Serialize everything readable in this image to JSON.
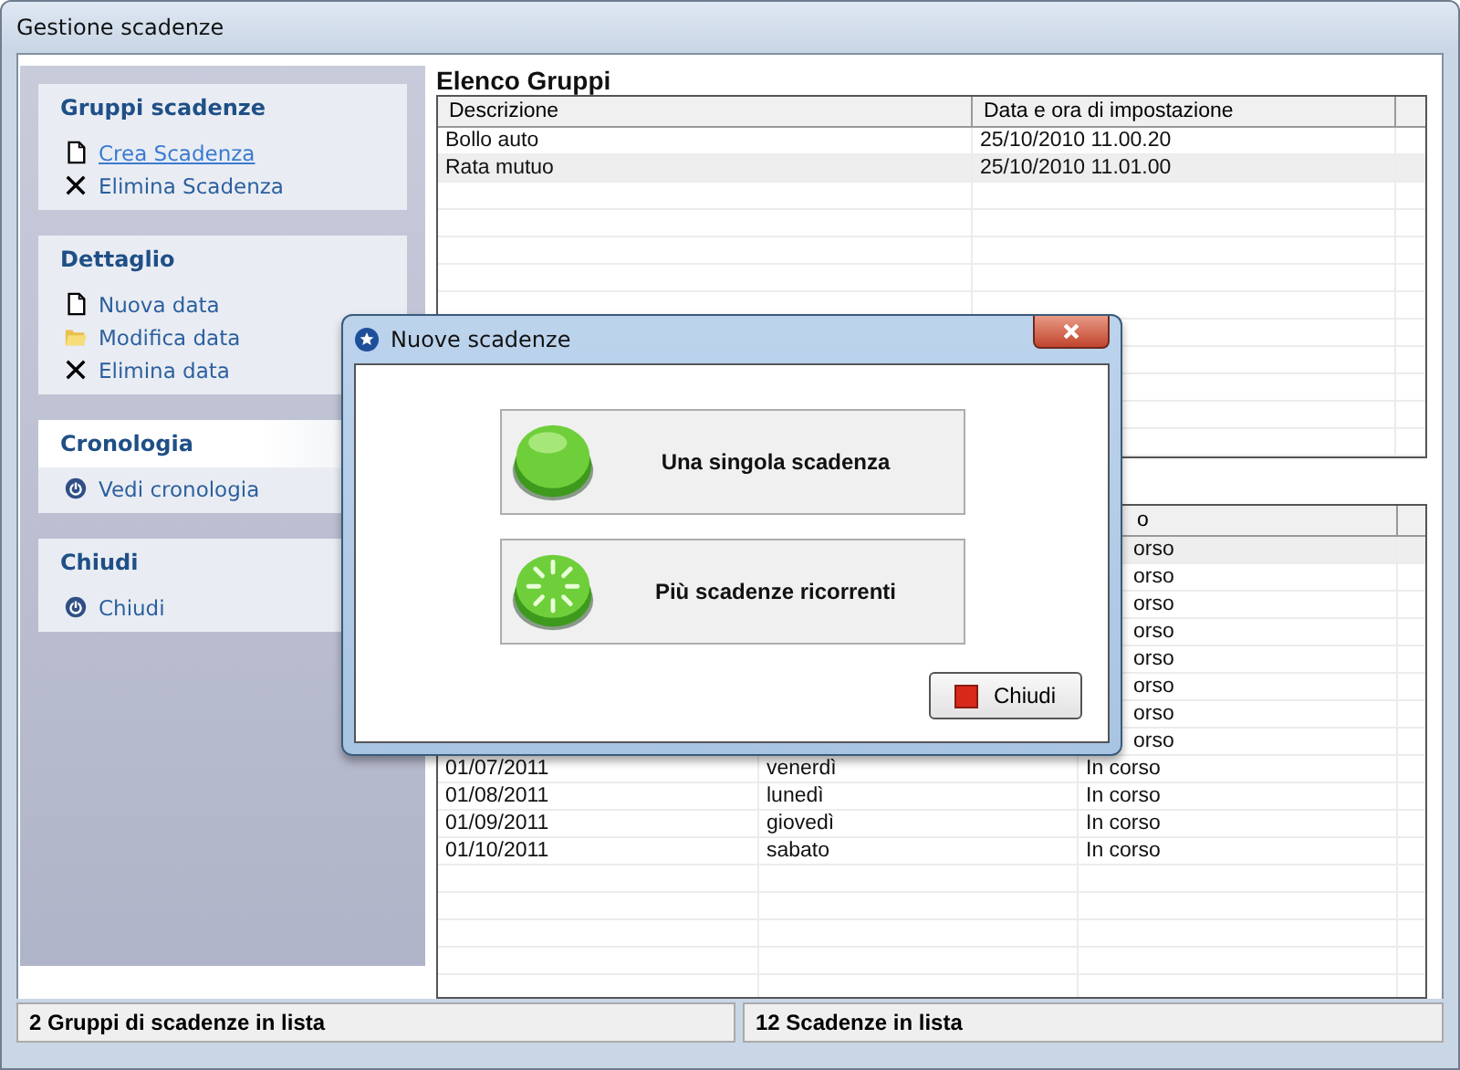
{
  "window": {
    "title": "Gestione scadenze"
  },
  "sidebar": {
    "sections": [
      {
        "title": "Gruppi scadenze",
        "highlighted": false,
        "items": [
          {
            "kind": "new",
            "label": "Crea Scadenza",
            "hovered": true
          },
          {
            "kind": "delete",
            "label": "Elimina Scadenza",
            "hovered": false
          }
        ]
      },
      {
        "title": "Dettaglio",
        "highlighted": false,
        "items": [
          {
            "kind": "new",
            "label": "Nuova data",
            "hovered": false
          },
          {
            "kind": "edit",
            "label": "Modifica data",
            "hovered": false
          },
          {
            "kind": "delete",
            "label": "Elimina data",
            "hovered": false
          }
        ]
      },
      {
        "title": "Cronologia",
        "highlighted": true,
        "items": [
          {
            "kind": "action",
            "label": "Vedi cronologia",
            "hovered": false
          }
        ]
      },
      {
        "title": "Chiudi",
        "highlighted": false,
        "items": [
          {
            "kind": "action",
            "label": "Chiudi",
            "hovered": false
          }
        ]
      }
    ]
  },
  "groups": {
    "title": "Elenco Gruppi",
    "columns": [
      "Descrizione",
      "Data e ora di impostazione"
    ],
    "rows": [
      {
        "cells": [
          "Bollo auto",
          "25/10/2010 11.00.20"
        ],
        "selected": false
      },
      {
        "cells": [
          "Rata mutuo",
          "25/10/2010 11.01.00"
        ],
        "selected": true
      }
    ]
  },
  "deadlines": {
    "column_3": "o",
    "rows": [
      {
        "column_3": "orso",
        "selected": true
      },
      {
        "column_3": "orso",
        "selected": false
      },
      {
        "column_3": "orso",
        "selected": false
      },
      {
        "column_3": "orso",
        "selected": false
      },
      {
        "column_3": "orso",
        "selected": false
      },
      {
        "column_3": "orso",
        "selected": false
      },
      {
        "column_3": "orso",
        "selected": false
      },
      {
        "column_3": "orso",
        "selected": false
      },
      {
        "cells": [
          "01/07/2011",
          "venerdì",
          "In corso"
        ],
        "selected": false
      },
      {
        "cells": [
          "01/08/2011",
          "lunedì",
          "In corso"
        ],
        "selected": false
      },
      {
        "cells": [
          "01/09/2011",
          "giovedì",
          "In corso"
        ],
        "selected": false
      },
      {
        "cells": [
          "01/10/2011",
          "sabato",
          "In corso"
        ],
        "selected": false
      }
    ]
  },
  "status_bar": [
    "2 Gruppi di scadenze in lista",
    "12 Scadenze in lista"
  ],
  "dialog": {
    "title": "Nuove scadenze",
    "options": [
      {
        "kind": "single",
        "label": "Una singola scadenza"
      },
      {
        "kind": "recurring",
        "label": "Più scadenze ricorrenti"
      }
    ],
    "close_button": "Chiudi"
  }
}
